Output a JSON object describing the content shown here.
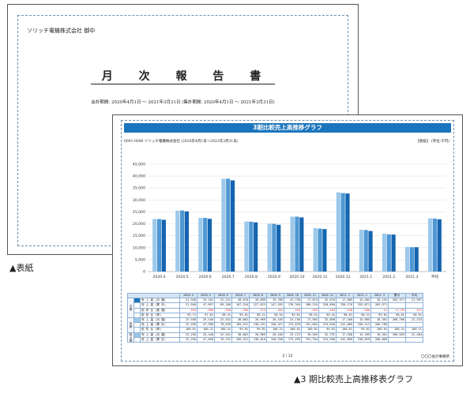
{
  "cover": {
    "company": "ソリッチ電機株式会社 御中",
    "title": "月 次 報 告 書",
    "period": "会計期間: 2020年4月1日 ～ 2021年3月31日 (集計期間: 2020年4月1日 ～ 2021年3月31日)",
    "caption": "▲表紙"
  },
  "report": {
    "title": "3期比較売上高推移グラフ",
    "company_line": "0001-0000 ソリッチ電機株式会社 (2020年4月1日～2021年3月31日)",
    "unit": "【税抜】 (単位:千円)",
    "page": "2 / 12",
    "firm": "〇〇〇会計事務所",
    "caption": "▲3 期比較売上高推移表グラフ",
    "colors": {
      "banner": "#1b75bc",
      "series_a": "#9cc8ea",
      "series_b": "#4f98d4",
      "series_c": "#1564b0"
    }
  },
  "chart_data": {
    "type": "bar",
    "categories": [
      "2020.4",
      "2020.5",
      "2020.6",
      "2020.7",
      "2020.8",
      "2020.9",
      "2020.10",
      "2020.11",
      "2020.12",
      "2021.1",
      "2021.2",
      "2021.3",
      "平均"
    ],
    "series": [
      {
        "values": [
          22000,
          25500,
          22500,
          38900,
          21000,
          20100,
          23000,
          18200,
          33200,
          17500,
          15900,
          10300,
          22300
        ]
      },
      {
        "values": [
          22000,
          25600,
          22500,
          38900,
          20900,
          20000,
          23000,
          18000,
          32900,
          17400,
          15600,
          10200,
          22200
        ]
      },
      {
        "values": [
          21700,
          25200,
          22100,
          38200,
          20600,
          19600,
          22700,
          17800,
          32700,
          17000,
          15500,
          10200,
          21900
        ]
      }
    ],
    "ylim": [
      0,
      45000
    ],
    "yticks": [
      "0",
      "5,000",
      "10,000",
      "15,000",
      "20,000",
      "25,000",
      "30,000",
      "35,000",
      "40,000",
      "45,000"
    ],
    "grid": true
  },
  "table": {
    "headers": [
      "2020.4",
      "2020.5",
      "2020.6",
      "2020.7",
      "2020.8",
      "2020.9",
      "2020.10",
      "2020.11",
      "2020.12",
      "2021.1",
      "2021.2",
      "2021.3",
      "累月",
      "平均"
    ],
    "groups": [
      {
        "label": "当期",
        "rows": [
          {
            "label": "売 上 高 (月 額)",
            "values": [
              "21,940",
              "25,101",
              "22,151",
              "38,076",
              "20,689",
              "19,789",
              "22,730",
              "17,874",
              "32,670",
              "17,069",
              "15,582",
              "10,192",
              "263,971",
              "21,997"
            ]
          },
          {
            "label": "売 上 高 (累 計)",
            "values": [
              "21,940",
              "47,057",
              "69,168",
              "107,244",
              "127,823",
              "147,592",
              "170,344",
              "188,218",
              "220,890",
              "238,176",
              "253,871",
              "263,971",
              "",
              ""
            ]
          },
          {
            "label": "前 年 比 (差 額)",
            "values": [
              "-934",
              "-566",
              "-358",
              "-356",
              "-373",
              "-263",
              "-254",
              "-264",
              "-183",
              "-248",
              "-286",
              "-21",
              "-3,739",
              "-312"
            ]
          },
          {
            "label": "前 年 比 (率)",
            "values": [
              "95.7%",
              "97.8%",
              "98.4%",
              "99.0%",
              "98.2%",
              "98.6%",
              "99.0%",
              "98.5%",
              "99.4%",
              "98.6%",
              "98.2%",
              "99.8%",
              "98.6%",
              "98.6%"
            ]
          }
        ]
      },
      {
        "label": "前期",
        "rows": [
          {
            "label": "売 上 高 (月 額)",
            "values": [
              "22,558",
              "25,440",
              "22,541",
              "38,862",
              "20,969",
              "20,105",
              "23,136",
              "17,983",
              "32,890",
              "17,260",
              "15,985",
              "10,301",
              "268,786",
              "22,233"
            ]
          },
          {
            "label": "売 上 高 (累 計)",
            "values": [
              "22,558",
              "47,998",
              "70,639",
              "109,521",
              "130,191",
              "150,327",
              "173,678",
              "191,662",
              "223,628",
              "241,089",
              "256,112",
              "266,786",
              "",
              ""
            ]
          },
          {
            "label": "前 年 比 (率)",
            "values": [
              "100.6%",
              "100.2%",
              "100.4%",
              "99.8%",
              "99.8%",
              "100.2%",
              "100.0%",
              "100.0%",
              "99.8%",
              "100.6%",
              "99.8%",
              "100.0%",
              "100.4%",
              "100.1%"
            ]
          }
        ]
      },
      {
        "label": "前々期",
        "rows": [
          {
            "label": "売 上 高 (月 額)",
            "values": [
              "22,250",
              "25,440",
              "22,541",
              "38,862",
              "20,969",
              "20,105",
              "23,172",
              "18,205",
              "32,792",
              "17,260",
              "15,789",
              "10,361",
              "266,659",
              "22,484"
            ]
          },
          {
            "label": "売 上 高 (累 計)",
            "values": [
              "22,250",
              "47,690",
              "70,231",
              "109,321",
              "130,010",
              "150,336",
              "173,499",
              "191,704",
              "224,996",
              "242,689",
              "258,659",
              "268,809",
              "",
              ""
            ]
          }
        ]
      }
    ]
  }
}
